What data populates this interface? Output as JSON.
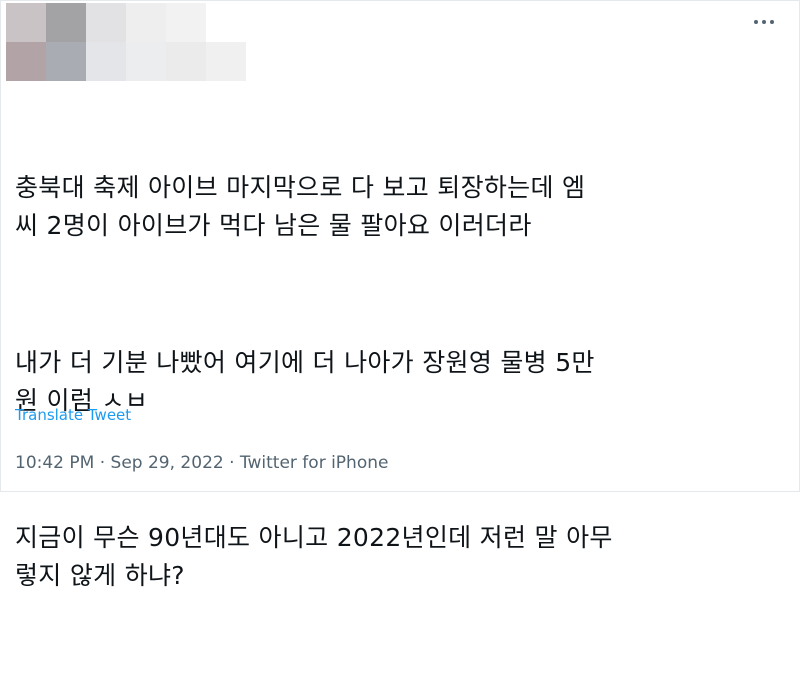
{
  "tweet": {
    "more_icon": "ellipsis-icon",
    "redacted_colors": [
      "#c9c3c5",
      "#a3a3a5",
      "#d7d7d9",
      "#e7e7e8",
      "#b2a4a6",
      "#a9acb3",
      "#d4d6d9",
      "#e2e2e4",
      "#ecedef",
      "#f0f0f0"
    ],
    "paragraphs": [
      "충북대 축제 아이브 마지막으로 다 보고 퇴장하는데 엠\n씨 2명이 아이브가 먹다 남은 물 팔아요 이러더라",
      "내가 더 기분 나빴어 여기에 더 나아가 장원영 물병 5만\n원 이럼 ㅅㅂ",
      "지금이 무슨 90년대도 아니고 2022년인데 저런 말 아무\n렇지 않게 하냐?"
    ],
    "translate_label": "Translate Tweet",
    "time": "10:42 PM",
    "date": "Sep 29, 2022",
    "source": "Twitter for iPhone",
    "separator": "·"
  }
}
